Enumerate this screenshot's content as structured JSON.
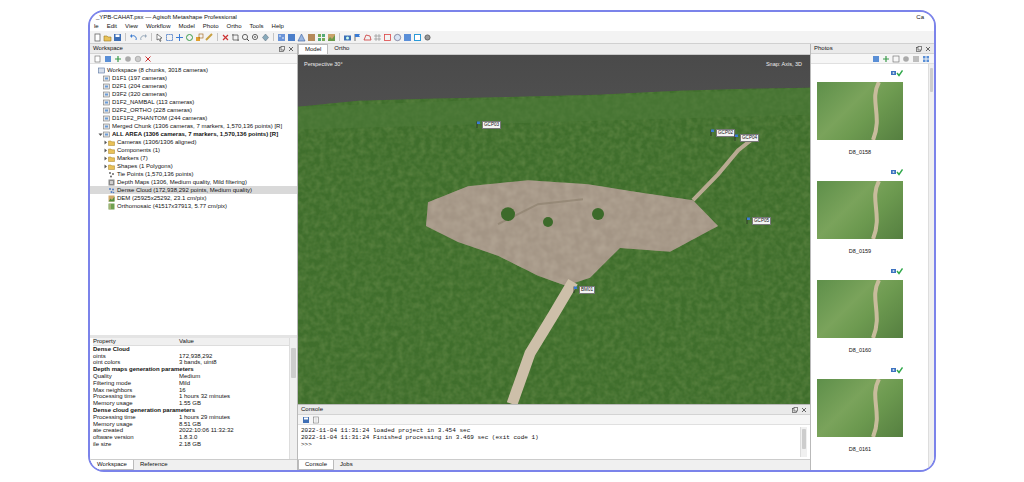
{
  "window": {
    "title": "_YPB-CAHAT.psx — Agisoft Metashape Professional",
    "corner_text": "Ca"
  },
  "menu": [
    "le",
    "Edit",
    "View",
    "Workflow",
    "Model",
    "Photo",
    "Ortho",
    "Tools",
    "Help"
  ],
  "workspace": {
    "title": "Workspace",
    "tree": [
      {
        "label": "Workspace (8 chunks, 3018 cameras)",
        "depth": 0,
        "kind": "workspace",
        "bold": false,
        "selected": false,
        "expandable": false,
        "expanded": true
      },
      {
        "label": "D1F1 (197 cameras)",
        "depth": 1,
        "kind": "chunk",
        "bold": false,
        "selected": false,
        "expandable": false,
        "expanded": false
      },
      {
        "label": "D2F1 (204 cameras)",
        "depth": 1,
        "kind": "chunk",
        "bold": false,
        "selected": false,
        "expandable": false,
        "expanded": false
      },
      {
        "label": "D3F2 (320 cameras)",
        "depth": 1,
        "kind": "chunk",
        "bold": false,
        "selected": false,
        "expandable": false,
        "expanded": false
      },
      {
        "label": "D1F2_NAMBAL (113 cameras)",
        "depth": 1,
        "kind": "chunk",
        "bold": false,
        "selected": false,
        "expandable": false,
        "expanded": false
      },
      {
        "label": "D2F2_ORTHO (228 cameras)",
        "depth": 1,
        "kind": "chunk",
        "bold": false,
        "selected": false,
        "expandable": false,
        "expanded": false
      },
      {
        "label": "D1F1F2_PHANTOM (244 cameras)",
        "depth": 1,
        "kind": "chunk",
        "bold": false,
        "selected": false,
        "expandable": false,
        "expanded": false
      },
      {
        "label": "Merged Chunk (1306 cameras, 7 markers, 1,570,136 points) [R]",
        "depth": 1,
        "kind": "chunk",
        "bold": false,
        "selected": false,
        "expandable": false,
        "expanded": false
      },
      {
        "label": "ALL AREA (1306 cameras, 7 markers, 1,570,136 points) [R]",
        "depth": 1,
        "kind": "chunk",
        "bold": true,
        "selected": false,
        "expandable": true,
        "expanded": true
      },
      {
        "label": "Cameras (1306/1306 aligned)",
        "depth": 2,
        "kind": "folder",
        "bold": false,
        "selected": false,
        "expandable": true,
        "expanded": false
      },
      {
        "label": "Components (1)",
        "depth": 2,
        "kind": "folder",
        "bold": false,
        "selected": false,
        "expandable": true,
        "expanded": false
      },
      {
        "label": "Markers (7)",
        "depth": 2,
        "kind": "folder",
        "bold": false,
        "selected": false,
        "expandable": true,
        "expanded": false
      },
      {
        "label": "Shapes (1 Polygons)",
        "depth": 2,
        "kind": "folder",
        "bold": false,
        "selected": false,
        "expandable": true,
        "expanded": false
      },
      {
        "label": "Tie Points (1,570,136 points)",
        "depth": 2,
        "kind": "tiepoints",
        "bold": false,
        "selected": false,
        "expandable": false,
        "expanded": false
      },
      {
        "label": "Depth Maps (1306, Medium quality, Mild filtering)",
        "depth": 2,
        "kind": "depth",
        "bold": false,
        "selected": false,
        "expandable": false,
        "expanded": false
      },
      {
        "label": "Dense Cloud (172,938,292 points, Medium quality)",
        "depth": 2,
        "kind": "dense",
        "bold": false,
        "selected": true,
        "expandable": false,
        "expanded": false
      },
      {
        "label": "DEM (25925x25292, 23.1 cm/pix)",
        "depth": 2,
        "kind": "dem",
        "bold": false,
        "selected": false,
        "expandable": false,
        "expanded": false
      },
      {
        "label": "Orthomosaic (41517x37913, 5.77 cm/pix)",
        "depth": 2,
        "kind": "ortho",
        "bold": false,
        "selected": false,
        "expandable": false,
        "expanded": false
      }
    ]
  },
  "properties": {
    "columns": [
      "Property",
      "Value"
    ],
    "rows": [
      {
        "kind": "section",
        "name": "Dense Cloud",
        "value": ""
      },
      {
        "kind": "row",
        "name": "oints",
        "value": "172,938,292"
      },
      {
        "kind": "row",
        "name": "oint colors",
        "value": "3 bands, uint8"
      },
      {
        "kind": "section",
        "name": "Depth maps generation parameters",
        "value": ""
      },
      {
        "kind": "row",
        "name": "Quality",
        "value": "Medium"
      },
      {
        "kind": "row",
        "name": "Filtering mode",
        "value": "Mild"
      },
      {
        "kind": "row",
        "name": "Max neighbors",
        "value": "16"
      },
      {
        "kind": "row",
        "name": "Processing time",
        "value": "1 hours 32 minutes"
      },
      {
        "kind": "row",
        "name": "Memory usage",
        "value": "1.55 GB"
      },
      {
        "kind": "section",
        "name": "Dense cloud generation parameters",
        "value": ""
      },
      {
        "kind": "row",
        "name": "Processing time",
        "value": "1 hours 29 minutes"
      },
      {
        "kind": "row",
        "name": "Memory usage",
        "value": "8.51 GB"
      },
      {
        "kind": "row",
        "name": "ate created",
        "value": "2022:10:06 11:32:32"
      },
      {
        "kind": "row",
        "name": "oftware version",
        "value": "1.8.3.0"
      },
      {
        "kind": "row",
        "name": "ile size",
        "value": "2.18 GB"
      }
    ]
  },
  "left_tabs": [
    {
      "label": "Workspace",
      "selected": true
    },
    {
      "label": "Reference",
      "selected": false
    }
  ],
  "view_tabs": [
    {
      "label": "Model",
      "selected": true
    },
    {
      "label": "Ortho",
      "selected": false
    }
  ],
  "viewport": {
    "projection": "Perspective 30°",
    "snap": "Snap: Axis, 3D",
    "markers": [
      {
        "label": "GCP03"
      },
      {
        "label": "GCP02"
      },
      {
        "label": "GCP04"
      },
      {
        "label": "GCP05"
      },
      {
        "label": "BM01"
      }
    ]
  },
  "console": {
    "title": "Console",
    "lines": [
      "2022-11-04 11:31:24 loaded project in 3.454 sec",
      "2022-11-04 11:31:24 Finished processing in 3.469 sec (exit code 1)",
      ">>>"
    ],
    "tabs": [
      {
        "label": "Console",
        "selected": true
      },
      {
        "label": "Jobs",
        "selected": false
      }
    ]
  },
  "photos": {
    "title": "Photos",
    "items": [
      {
        "label": "D8_0158",
        "aligned": true
      },
      {
        "label": "D8_0159",
        "aligned": true
      },
      {
        "label": "D8_0160",
        "aligned": true
      },
      {
        "label": "D8_0161",
        "aligned": true
      }
    ]
  }
}
